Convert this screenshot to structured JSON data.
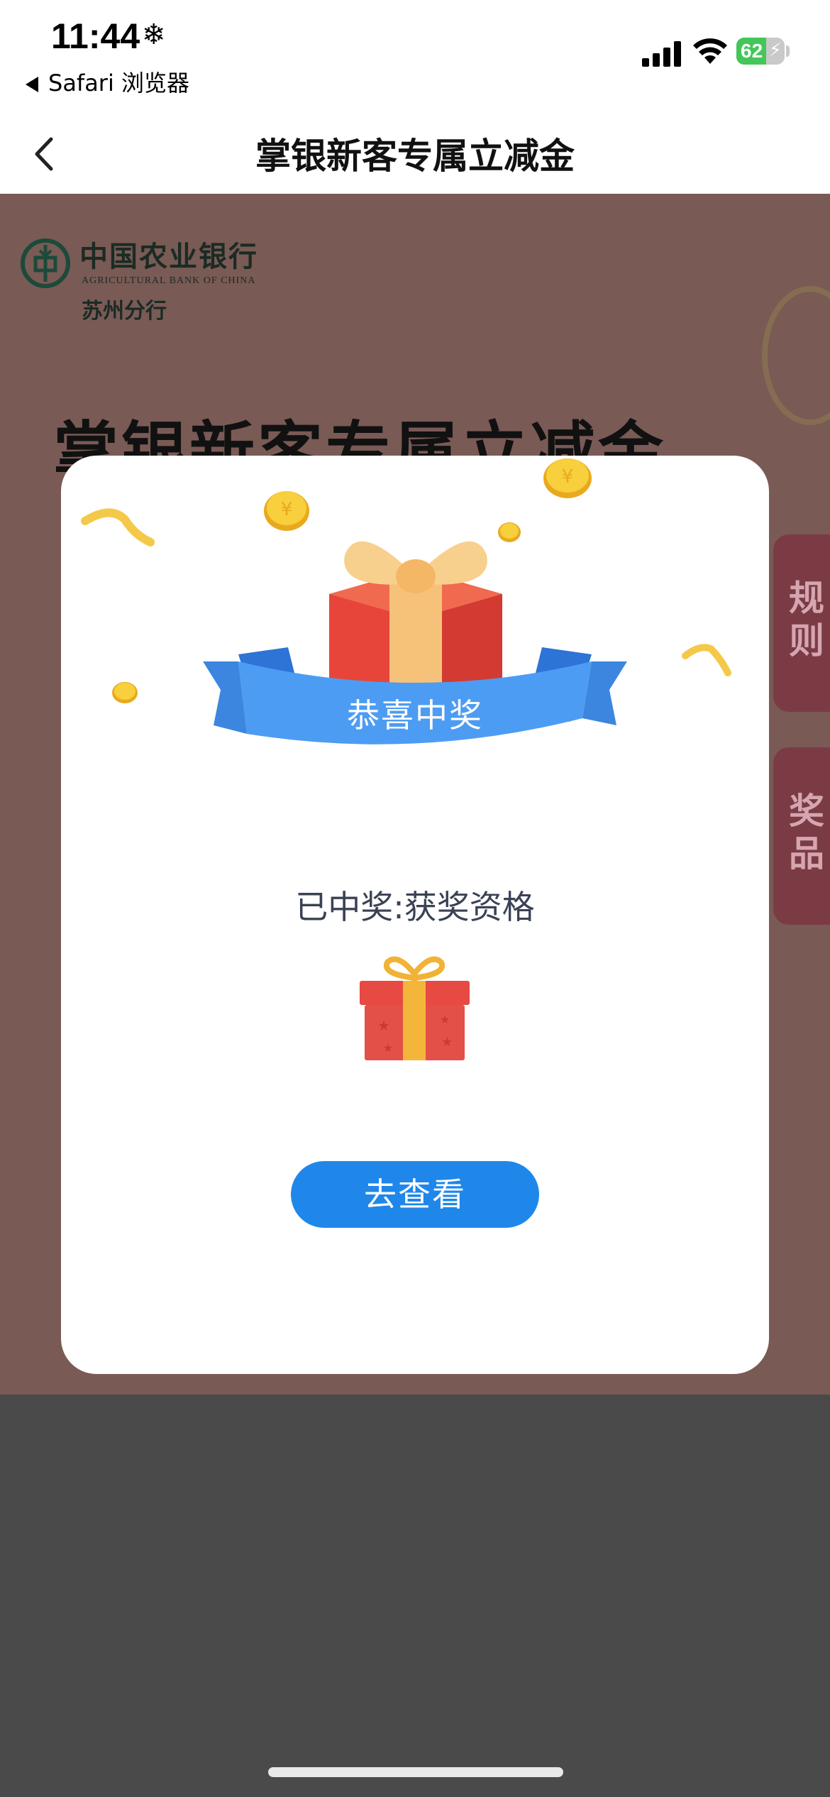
{
  "status_bar": {
    "time": "11:44",
    "back_app": "Safari 浏览器",
    "battery": "62",
    "battery_level": 0.62
  },
  "nav": {
    "title": "掌银新客专属立减金",
    "back_icon": "chevron-left-icon"
  },
  "background_page": {
    "bank_name": "中国农业银行",
    "bank_name_en": "AGRICULTURAL BANK OF CHINA",
    "branch": "苏州分行",
    "headline": "掌银新客专属立减金",
    "side_buttons": {
      "rules": [
        "规",
        "则"
      ],
      "prizes": [
        "奖",
        "品"
      ]
    }
  },
  "modal": {
    "banner_label": "恭喜中奖",
    "prize_text": "已中奖:获奖资格",
    "view_button": "去查看"
  },
  "colors": {
    "accent_blue": "#1f87ea",
    "overlay": "#4a4a4a",
    "ribbon_blue": "#3f8fe8",
    "gift_red": "#e8453a",
    "coin_gold": "#f4c32a",
    "battery_green": "#44c65a"
  }
}
